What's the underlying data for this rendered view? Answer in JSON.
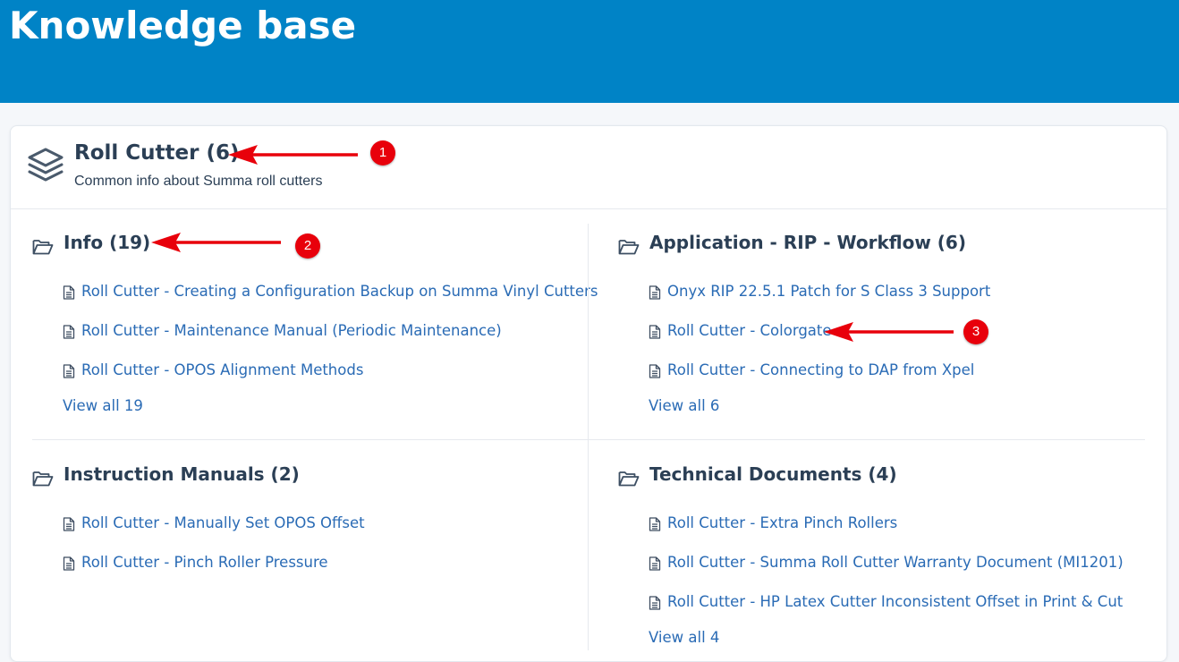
{
  "header": {
    "title": "Knowledge base"
  },
  "category": {
    "title": "Roll Cutter (6)",
    "description": "Common info about Summa roll cutters",
    "icon": "layers-icon"
  },
  "sections": [
    {
      "title": "Info (19)",
      "icon": "folder-open-icon",
      "articles": [
        "Roll Cutter - Creating a Configuration Backup on Summa Vinyl Cutters",
        "Roll Cutter - Maintenance Manual (Periodic Maintenance)",
        "Roll Cutter - OPOS Alignment Methods"
      ],
      "view_all": "View all 19"
    },
    {
      "title": "Application - RIP - Workflow (6)",
      "icon": "folder-open-icon",
      "articles": [
        "Onyx RIP 22.5.1 Patch for S Class 3 Support",
        "Roll Cutter - Colorgate",
        "Roll Cutter - Connecting to DAP from Xpel"
      ],
      "view_all": "View all 6"
    },
    {
      "title": "Instruction Manuals (2)",
      "icon": "folder-open-icon",
      "articles": [
        "Roll Cutter - Manually Set OPOS Offset",
        "Roll Cutter - Pinch Roller Pressure"
      ]
    },
    {
      "title": "Technical Documents (4)",
      "icon": "folder-open-icon",
      "articles": [
        "Roll Cutter - Extra Pinch Rollers",
        "Roll Cutter - Summa Roll Cutter Warranty Document (MI1201)",
        "Roll Cutter - HP Latex Cutter Inconsistent Offset in Print & Cut"
      ],
      "view_all": "View all 4"
    }
  ],
  "annotations": [
    {
      "number": "1"
    },
    {
      "number": "2"
    },
    {
      "number": "3"
    }
  ],
  "colors": {
    "header_bg": "#0083c6",
    "link": "#2a6bb5",
    "heading": "#2b3f55",
    "annotation": "#e8000b"
  }
}
